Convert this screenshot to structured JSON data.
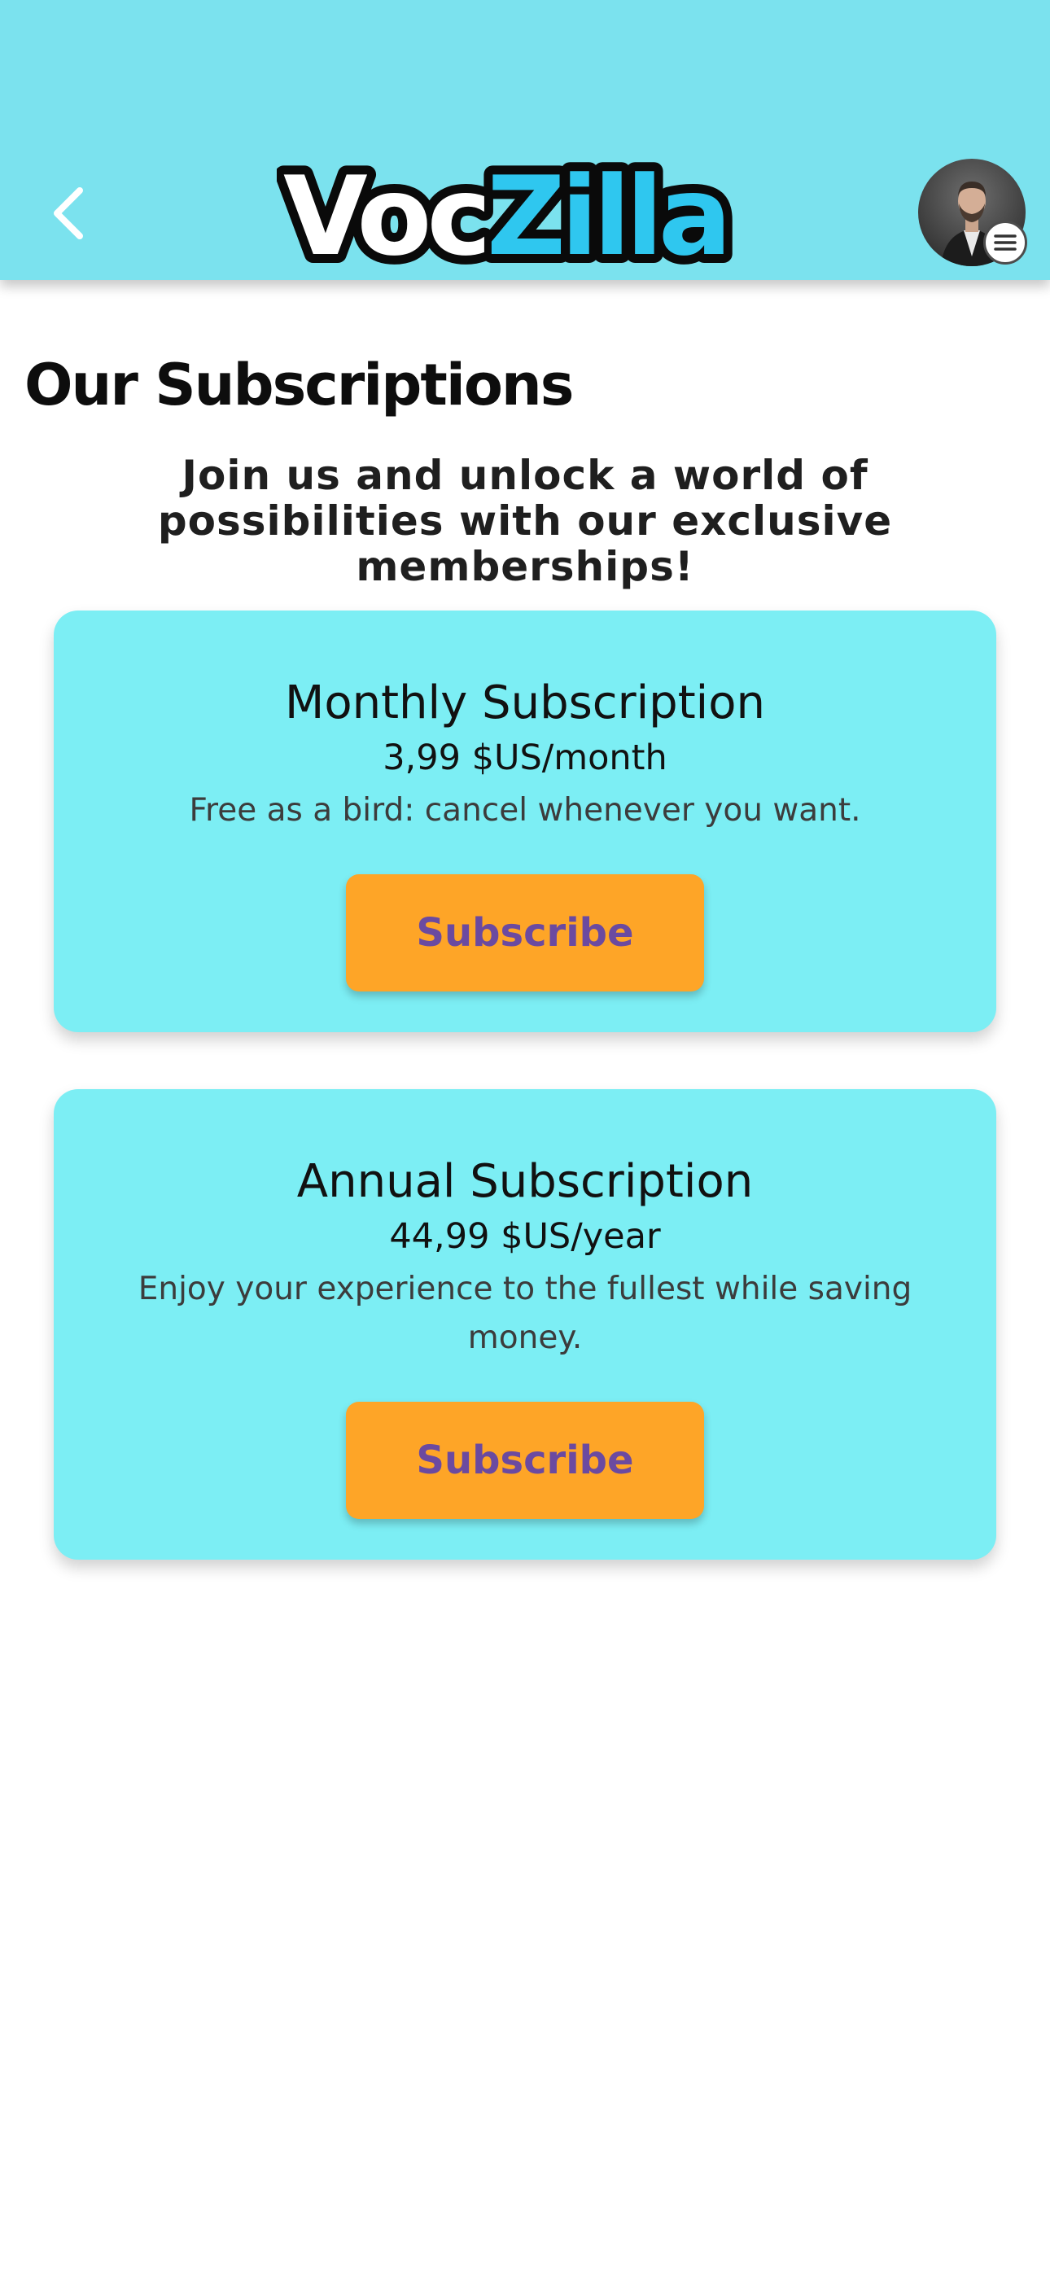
{
  "header": {
    "back_icon": "chevron-left-icon",
    "logo": {
      "part1": "Voc",
      "part2": "Zilla"
    },
    "avatar_icon": "user-avatar",
    "menu_icon": "hamburger-menu-icon",
    "colors": {
      "header_bg": "#7be2ee",
      "logo_accent": "#2fc7ef"
    }
  },
  "page": {
    "title": "Our Subscriptions",
    "subtitle": "Join us and unlock a world of possibilities with our exclusive memberships!"
  },
  "plans": [
    {
      "title": "Monthly Subscription",
      "price": "3,99 $US/month",
      "description": "Free as a bird: cancel whenever you want.",
      "button_label": "Subscribe"
    },
    {
      "title": "Annual Subscription",
      "price": "44,99 $US/year",
      "description": "Enjoy your experience to the fullest while saving money.",
      "button_label": "Subscribe"
    }
  ],
  "colors": {
    "card_bg": "#7ceef4",
    "button_bg": "#fea527",
    "button_text": "#6b4aa0"
  }
}
